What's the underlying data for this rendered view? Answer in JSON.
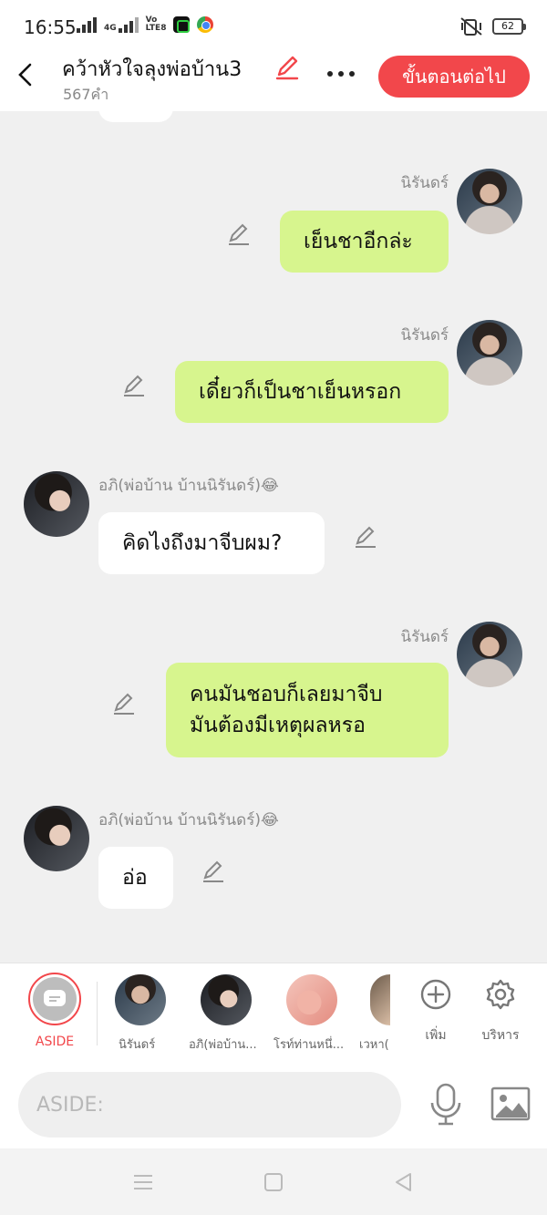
{
  "status": {
    "time": "16:55",
    "net_labels": [
      "4G",
      "Vo",
      "LTE8"
    ],
    "battery": "62"
  },
  "header": {
    "back_icon": "back-arrow-icon",
    "title": "คว้าหัวใจลุงพ่อบ้าน3",
    "word_count": "567คำ",
    "next_label": "ขั้นตอนต่อไป"
  },
  "messages": [
    {
      "side": "right",
      "name": "นิรันดร์",
      "text": "เย็นชาอีกล่ะ"
    },
    {
      "side": "right",
      "name": "นิรันดร์",
      "text": "เดี๋ยวก็เป็นชาเย็นหรอก"
    },
    {
      "side": "left",
      "name": "อภิ(พ่อบ้าน บ้านนิรันดร์)😂",
      "text": "คิดไงถึงมาจีบผม?"
    },
    {
      "side": "right",
      "name": "นิรันดร์",
      "text_lines": [
        "คนมันชอบก็เลยมาจีบ",
        "มันต้องมีเหตุผลหรอ"
      ]
    },
    {
      "side": "left",
      "name": "อภิ(พ่อบ้าน บ้านนิรันดร์)😂",
      "text": "อ่อ"
    }
  ],
  "characters": {
    "aside_label": "ASIDE",
    "items": [
      "นิรันดร์",
      "อภิ(พ่อบ้าน...",
      "โรท์ท่านหนึ่...",
      "เวหา("
    ],
    "add_label": "เพิ่ม",
    "manage_label": "บริหาร"
  },
  "composer": {
    "placeholder": "ASIDE:"
  },
  "colors": {
    "accent": "#f2474b",
    "my_bubble": "#d7f58e",
    "their_bubble": "#ffffff"
  }
}
